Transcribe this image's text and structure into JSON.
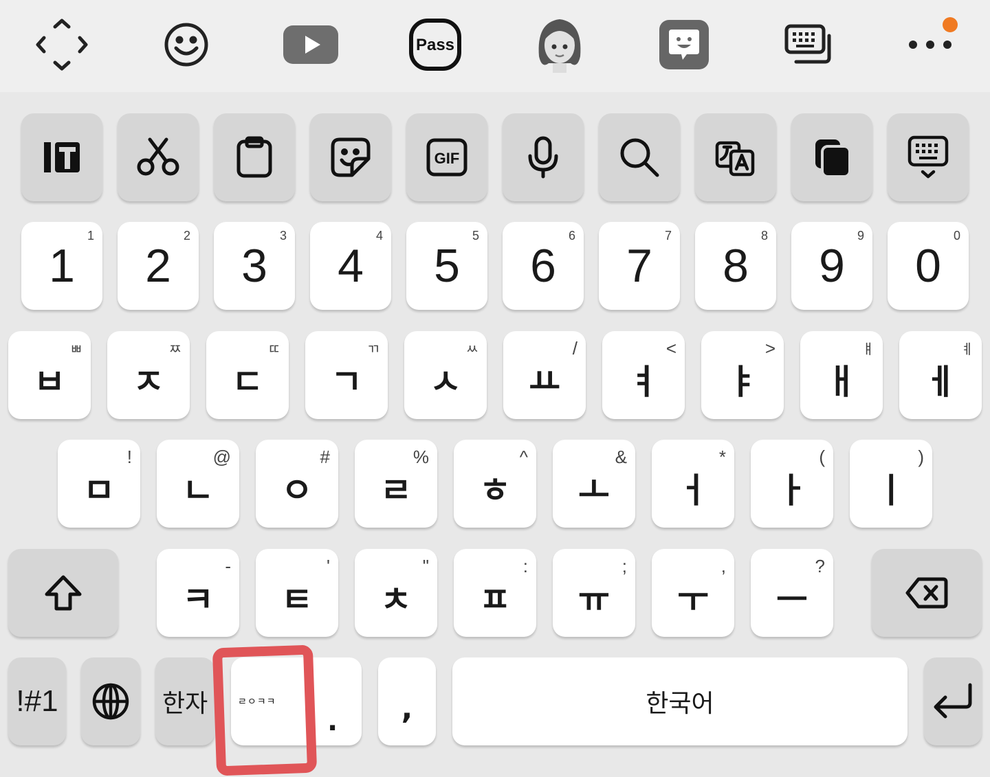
{
  "toolbar": {
    "icons": [
      "keyboard-mode-icon",
      "emoji-icon",
      "youtube-icon",
      "pass-icon",
      "avatar-icon",
      "bitmoji-icon",
      "keyboard-switch-icon",
      "more-icon"
    ],
    "pass_label": "Pass",
    "notification_dot_color": "#f07a22"
  },
  "tool_row": {
    "icons": [
      "text-editing-icon",
      "scissors-icon",
      "clipboard-icon",
      "sticker-icon",
      "gif-icon",
      "microphone-icon",
      "search-icon",
      "translate-icon",
      "copy-icon",
      "keyboard-hide-icon"
    ],
    "gif_label": "GIF"
  },
  "number_row": [
    {
      "main": "1",
      "sub": "1"
    },
    {
      "main": "2",
      "sub": "2"
    },
    {
      "main": "3",
      "sub": "3"
    },
    {
      "main": "4",
      "sub": "4"
    },
    {
      "main": "5",
      "sub": "5"
    },
    {
      "main": "6",
      "sub": "6"
    },
    {
      "main": "7",
      "sub": "7"
    },
    {
      "main": "8",
      "sub": "8"
    },
    {
      "main": "9",
      "sub": "9"
    },
    {
      "main": "0",
      "sub": "0"
    }
  ],
  "row1": [
    {
      "main": "ㅂ",
      "sub": "ㅃ"
    },
    {
      "main": "ㅈ",
      "sub": "ㅉ"
    },
    {
      "main": "ㄷ",
      "sub": "ㄸ"
    },
    {
      "main": "ㄱ",
      "sub": "ㄲ"
    },
    {
      "main": "ㅅ",
      "sub": "ㅆ"
    },
    {
      "main": "ㅛ",
      "sub": "/"
    },
    {
      "main": "ㅕ",
      "sub": "<"
    },
    {
      "main": "ㅑ",
      "sub": ">"
    },
    {
      "main": "ㅐ",
      "sub": "ㅒ"
    },
    {
      "main": "ㅔ",
      "sub": "ㅖ"
    }
  ],
  "row2": [
    {
      "main": "ㅁ",
      "sub": "!"
    },
    {
      "main": "ㄴ",
      "sub": "@"
    },
    {
      "main": "ㅇ",
      "sub": "#"
    },
    {
      "main": "ㄹ",
      "sub": "%"
    },
    {
      "main": "ㅎ",
      "sub": "^"
    },
    {
      "main": "ㅗ",
      "sub": "&"
    },
    {
      "main": "ㅓ",
      "sub": "*"
    },
    {
      "main": "ㅏ",
      "sub": "("
    },
    {
      "main": "ㅣ",
      "sub": ")"
    }
  ],
  "row3": [
    {
      "main": "ㅋ",
      "sub": "-"
    },
    {
      "main": "ㅌ",
      "sub": "'"
    },
    {
      "main": "ㅊ",
      "sub": "\""
    },
    {
      "main": "ㅍ",
      "sub": ":"
    },
    {
      "main": "ㅠ",
      "sub": ";"
    },
    {
      "main": "ㅜ",
      "sub": ","
    },
    {
      "main": "ㅡ",
      "sub": "?"
    }
  ],
  "bottom_row": {
    "symbols_label": "!#1",
    "hanja_label": "한자",
    "suggestion_text": "ㄹㅇㅋㅋ",
    "period_label": ".",
    "comma_label": ",",
    "space_label": "한국어"
  }
}
